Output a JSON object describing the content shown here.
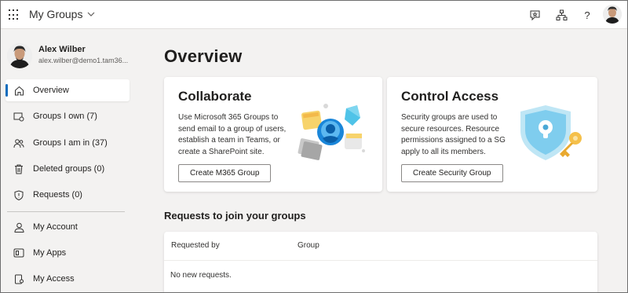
{
  "topbar": {
    "app_title": "My Groups",
    "icons": [
      "waffle-icon",
      "feedback-icon",
      "org-chart-icon",
      "help-icon"
    ],
    "help_glyph": "?"
  },
  "profile": {
    "name": "Alex Wilber",
    "email": "alex.wilber@demo1.tam36..."
  },
  "nav": {
    "items": [
      {
        "label": "Overview",
        "icon": "home-icon",
        "active": true
      },
      {
        "label": "Groups I own (7)",
        "icon": "groups-owned-icon"
      },
      {
        "label": "Groups I am in (37)",
        "icon": "people-icon"
      },
      {
        "label": "Deleted groups (0)",
        "icon": "trash-icon"
      },
      {
        "label": "Requests (0)",
        "icon": "shield-icon"
      },
      {
        "label": "My Account",
        "icon": "account-icon"
      },
      {
        "label": "My Apps",
        "icon": "apps-icon"
      },
      {
        "label": "My Access",
        "icon": "key-icon"
      }
    ]
  },
  "main": {
    "title": "Overview",
    "collaborate": {
      "title": "Collaborate",
      "description": "Use Microsoft 365 Groups to send email to a group of users, establish a team in Teams, or create a SharePoint site.",
      "button": "Create M365 Group"
    },
    "control_access": {
      "title": "Control Access",
      "description": "Security groups are used to secure resources. Resource permissions assigned to a SG apply to all its members.",
      "button": "Create Security Group"
    },
    "requests": {
      "title": "Requests to join your groups",
      "columns": [
        "Requested by",
        "Group"
      ],
      "empty_text": "No new requests."
    }
  },
  "colors": {
    "accent": "#0f6cbd",
    "background": "#f3f2f1",
    "card": "#ffffff"
  }
}
